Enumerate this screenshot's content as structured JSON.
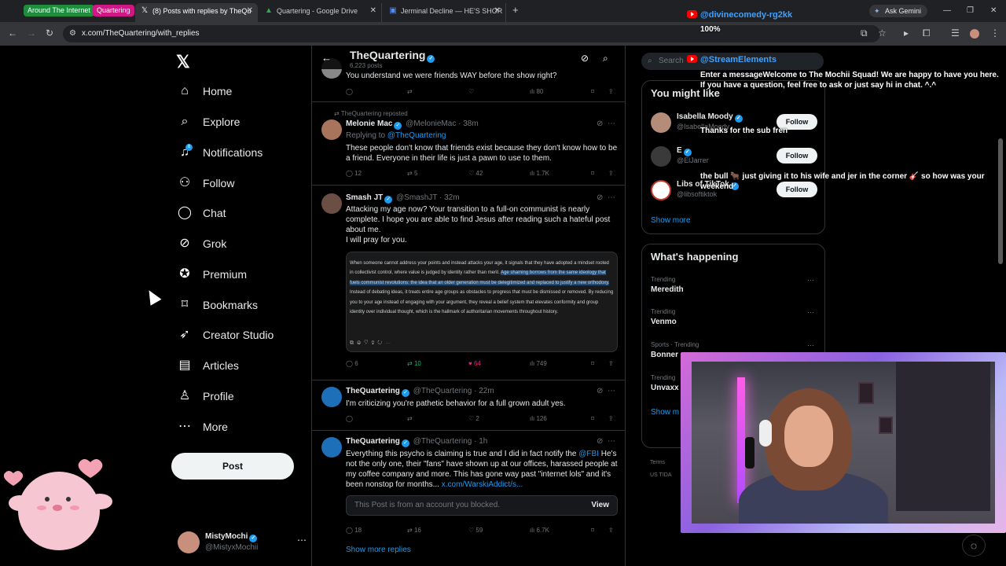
{
  "browser": {
    "tab_groups": [
      {
        "label": "Around The Internet",
        "color": "#1e8e3e"
      },
      {
        "label": "Quartering",
        "color": "#d01884"
      }
    ],
    "tabs": [
      {
        "title": "(8) Posts with replies by TheQu",
        "icon": "x-logo-icon",
        "active": true
      },
      {
        "title": "Quartering - Google Drive",
        "icon": "drive-icon",
        "active": false
      },
      {
        "title": "Jerminal Decline — HE'S SHOR",
        "icon": "substack-icon",
        "active": false
      }
    ],
    "url": "x.com/TheQuartering/with_replies",
    "gemini_label": "Ask Gemini"
  },
  "nav": {
    "items": [
      {
        "label": "Home",
        "icon": "home-icon"
      },
      {
        "label": "Explore",
        "icon": "search-icon"
      },
      {
        "label": "Notifications",
        "icon": "bell-icon"
      },
      {
        "label": "Follow",
        "icon": "add-person-icon"
      },
      {
        "label": "Chat",
        "icon": "chat-icon"
      },
      {
        "label": "Grok",
        "icon": "grok-icon"
      },
      {
        "label": "Premium",
        "icon": "premium-icon"
      },
      {
        "label": "Bookmarks",
        "icon": "bookmark-icon"
      },
      {
        "label": "Creator Studio",
        "icon": "rocket-icon"
      },
      {
        "label": "Articles",
        "icon": "articles-icon"
      },
      {
        "label": "Profile",
        "icon": "person-icon"
      },
      {
        "label": "More",
        "icon": "more-icon"
      }
    ],
    "notification_badge": "8",
    "post_label": "Post",
    "account": {
      "name": "MistyMochi",
      "handle": "@MistyxMochii"
    }
  },
  "timeline": {
    "title": "TheQuartering",
    "subtitle": "6,223 posts",
    "top_snippet": "You understand we were friends WAY before the show right?",
    "top_actions": {
      "views": "80"
    },
    "posts": [
      {
        "repost_line": "TheQuartering reposted",
        "name": "Melonie Mac",
        "handle": "@MelonieMac",
        "time": "· 38m",
        "reply_prefix": "Replying to ",
        "reply_handle": "@TheQuartering",
        "text": "These people don't know that friends exist because they don't know how to be a friend. Everyone in their life is just a pawn to use to them.",
        "replies": "12",
        "reposts": "5",
        "likes": "42",
        "views": "1.7K"
      },
      {
        "name": "Smash JT",
        "handle": "@SmashJT",
        "time": "· 32m",
        "text": "Attacking my age now? Your transition to a full-on communist is nearly complete. I hope you are able to find Jesus after reading such a hateful post about me.",
        "text2": "I will pray for you.",
        "image_text_a": "When someone cannot address your points and instead attacks your age, it signals that they have adopted a mindset rooted in collectivist control, where value is judged by identity rather than merit. ",
        "image_text_hl": "Age shaming borrows from the same ideology that fuels communist revolutions: the idea that an older generation must be delegitimized and replaced to justify a new orthodoxy.",
        "image_text_b": " Instead of debating ideas, it treats entire age groups as obstacles to progress that must be dismissed or removed. By reducing you to your age instead of engaging with your argument, they reveal a belief system that elevates conformity and group identity over individual thought, which is the hallmark of authoritarian movements throughout history.",
        "replies": "6",
        "reposts": "10",
        "likes": "64",
        "views": "749"
      },
      {
        "name": "TheQuartering",
        "handle": "@TheQuartering",
        "time": "· 22m",
        "text": "I'm criticizing you're pathetic behavior for a full grown adult yes.",
        "replies": "",
        "reposts": "",
        "likes": "2",
        "views": "126"
      },
      {
        "name": "TheQuartering",
        "handle": "@TheQuartering",
        "time": "· 1h",
        "text_a": "Everything this psycho is claiming is true and I did in fact notify the ",
        "text_mention": "@FBI",
        "text_b": " He's not the only one, their \"fans\" have shown up at our offices, harassed people at my coffee company and more.  This has gone way past \"internet lols\" and it's been nonstop for months... ",
        "text_link": "x.com/WarskiAddict/s...",
        "blocked_text": "This Post is from an account you blocked.",
        "blocked_view": "View",
        "replies": "18",
        "reposts": "16",
        "likes": "59",
        "views": "6.7K"
      }
    ],
    "show_more_replies": "Show more replies"
  },
  "sidebar": {
    "search_placeholder": "Search",
    "you_might_like": "You might like",
    "suggestions": [
      {
        "name": "Isabella Moody",
        "handle": "@IsabellaMoody",
        "button": "Follow"
      },
      {
        "name": "E",
        "handle": "@ElJarrer",
        "button": "Follow"
      },
      {
        "name": "Libs of TikTok",
        "handle": "@libsoftiktok",
        "button": "Follow"
      }
    ],
    "show_more": "Show more",
    "whats_happening": "What's happening",
    "trends": [
      {
        "category": "Trending",
        "name": "Meredith"
      },
      {
        "category": "Trending",
        "name": "Venmo"
      },
      {
        "category": "Sports · Trending",
        "name": "Bonner"
      },
      {
        "category": "Trending",
        "name": "Unvaxx"
      }
    ],
    "trends_show_more": "Show m",
    "footer1": "Terms",
    "footer2": "US TIDA"
  },
  "stream": {
    "chat1_user": "@divinecomedy-rg2kk",
    "chat1_msg": "100%",
    "chat2_user": "@StreamElements",
    "chat2_msg": "Enter a messageWelcome to The Mochii Squad! We are happy to have you here. If you have a question, feel free to ask or just say hi in chat. ^.^",
    "chat3_msg": "Thanks for the sub fren",
    "chat4_msg": "the bull 🐂 just giving it to his wife and jer in the corner 🎸 so how was your weekend"
  },
  "colors": {
    "accent": "#1d9bf0",
    "like": "#f91880",
    "repost": "#00ba7c",
    "youtube": "#ff0000"
  }
}
